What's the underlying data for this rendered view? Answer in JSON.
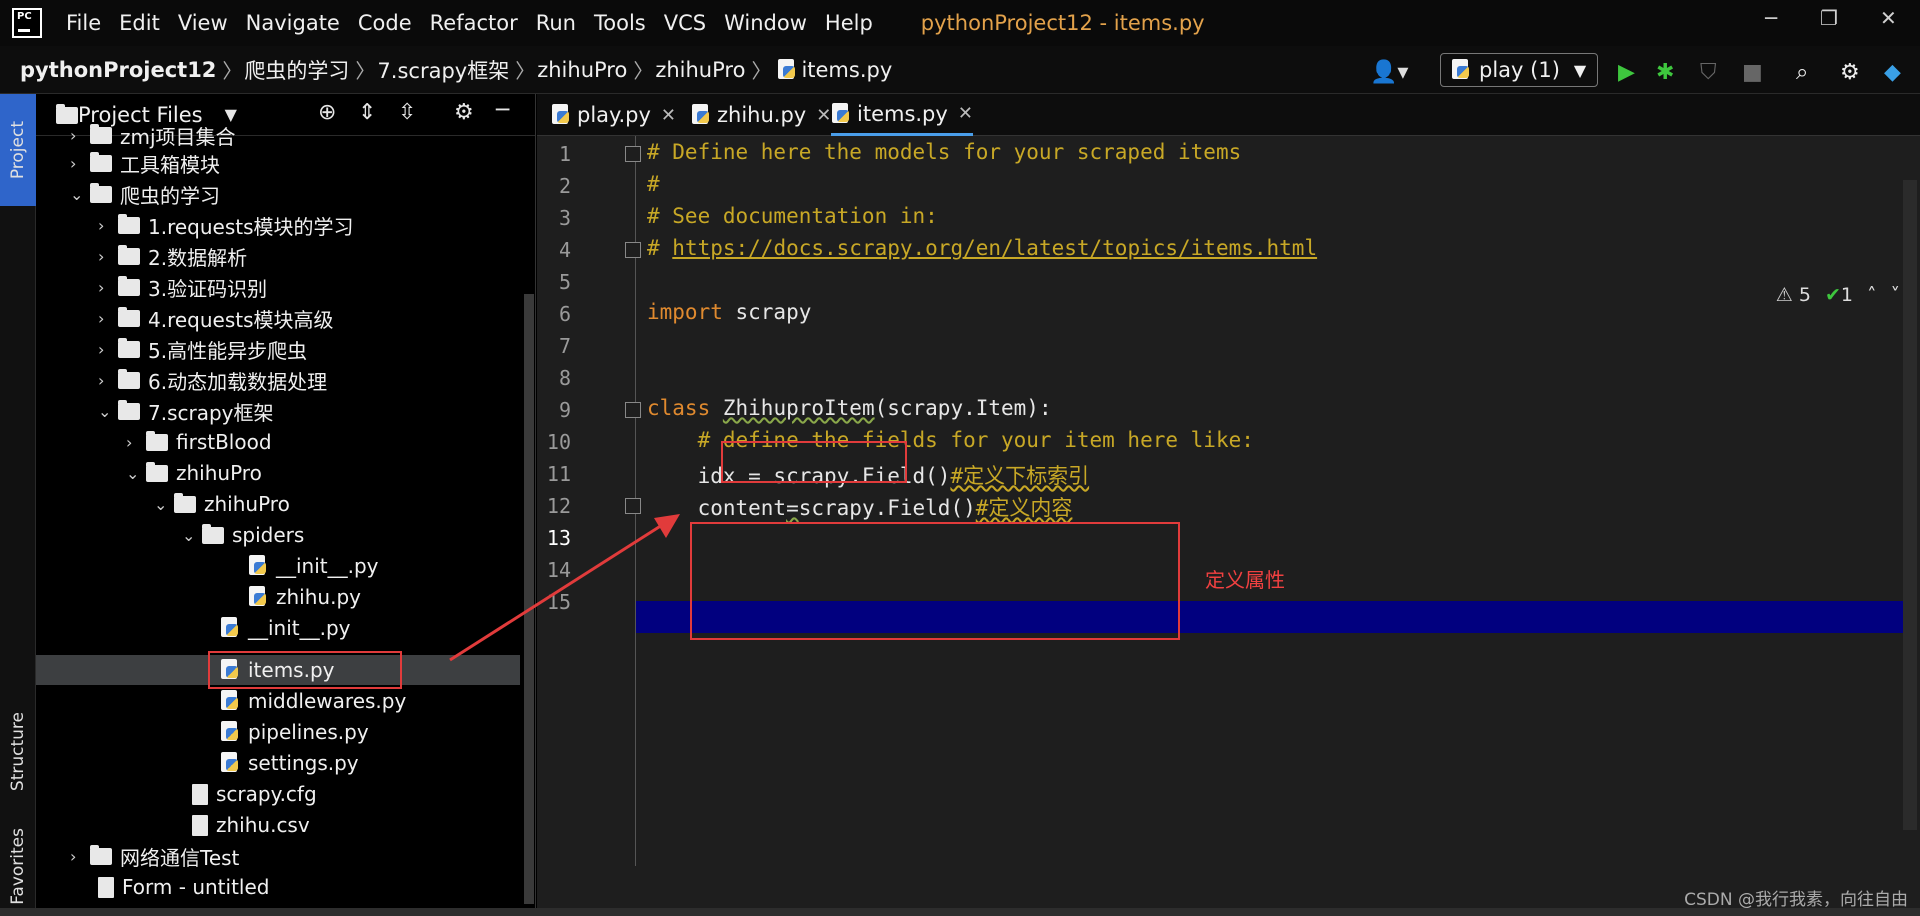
{
  "menubar": {
    "items": [
      "File",
      "Edit",
      "View",
      "Navigate",
      "Code",
      "Refactor",
      "Run",
      "Tools",
      "VCS",
      "Window",
      "Help"
    ],
    "title": "pythonProject12 - items.py",
    "logo_text": "PC"
  },
  "breadcrumb": [
    "pythonProject12",
    "爬虫的学习",
    "7.scrapy框架",
    "zhihuPro",
    "zhihuPro",
    "items.py"
  ],
  "toolbar": {
    "run_config": "play (1)"
  },
  "leftstrip": {
    "project": "Project",
    "structure": "Structure",
    "favorites": "Favorites"
  },
  "project_panel": {
    "title": "Project Files",
    "tree": [
      "zmj项目集合",
      "工具箱模块",
      "爬虫的学习",
      "1.requests模块的学习",
      "2.数据解析",
      "3.验证码识别",
      "4.requests模块高级",
      "5.高性能异步爬虫",
      "6.动态加载数据处理",
      "7.scrapy框架",
      "firstBlood",
      "zhihuPro",
      "zhihuPro",
      "spiders",
      "__init__.py",
      "zhihu.py",
      "__init__.py",
      "items.py",
      "middlewares.py",
      "pipelines.py",
      "settings.py",
      "scrapy.cfg",
      "zhihu.csv",
      "网络通信Test",
      "Form - untitled"
    ]
  },
  "tabs": [
    "play.py",
    "zhihu.py",
    "items.py"
  ],
  "editor": {
    "line_numbers": [
      "1",
      "2",
      "3",
      "4",
      "5",
      "6",
      "7",
      "8",
      "9",
      "10",
      "11",
      "12",
      "13",
      "14",
      "15"
    ],
    "l1": "# Define here the models for your scraped items",
    "l2": "#",
    "l3": "# See documentation in:",
    "l4a": "# ",
    "l4b": "https://docs.scrapy.org/en/latest/topics/items.html",
    "l6a": "import",
    "l6b": " scrapy",
    "l9a": "class",
    "l9b": " ",
    "l9c": "ZhihuproItem",
    "l9d": "(scrapy.Item):",
    "l10": "    # define the fields for your item here like:",
    "l11a": "    idx = scrapy.Field()",
    "l11b": "#定义下标索引",
    "l12a": "    content",
    "l12b": "=",
    "l12c": "scrapy.Field()",
    "l12d": "#定义内容"
  },
  "inspection": {
    "warnings": "5",
    "ok": "1"
  },
  "annotation": "定义属性",
  "watermark": "CSDN @我行我素，向往自由",
  "colors": {
    "accent": "#2f65ca",
    "current_line": "#01007f",
    "comment": "#c8a826",
    "keyword": "#e08a2f",
    "annotation": "#e13b3b"
  }
}
